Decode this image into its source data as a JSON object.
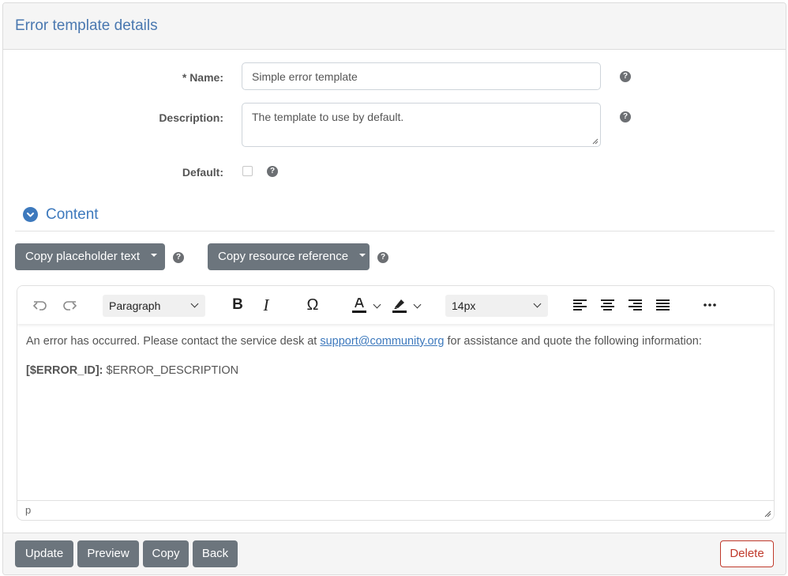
{
  "header": {
    "title": "Error template details"
  },
  "form": {
    "name_label": "* Name:",
    "name_value": "Simple error template",
    "description_label": "Description:",
    "description_value": "The template to use by default.",
    "default_label": "Default:",
    "default_checked": false
  },
  "help_glyph": "?",
  "content_section": {
    "title": "Content",
    "copy_placeholder_label": "Copy placeholder text",
    "copy_resource_label": "Copy resource reference"
  },
  "editor": {
    "block_format": "Paragraph",
    "font_size": "14px",
    "text_before_link": "An error has occurred. Please contact the service desk at ",
    "link_text": "support@community.org",
    "text_after_link": " for assistance and quote the following information:",
    "error_id_token": "[$ERROR_ID]:",
    "error_desc_token": " $ERROR_DESCRIPTION",
    "status_path": "p"
  },
  "footer": {
    "update_label": "Update",
    "preview_label": "Preview",
    "copy_label": "Copy",
    "back_label": "Back",
    "delete_label": "Delete"
  },
  "colors": {
    "accent": "#3d79bd",
    "title": "#4a78b0",
    "button_bg": "#6c757d",
    "danger": "#c0392b"
  },
  "icons": [
    "undo-icon",
    "redo-icon",
    "bold-icon",
    "italic-icon",
    "omega-icon",
    "text-color-icon",
    "highlight-icon",
    "align-left-icon",
    "align-center-icon",
    "align-right-icon",
    "align-justify-icon",
    "more-icon",
    "help-icon",
    "chevron-down-icon",
    "resize-handle-icon"
  ]
}
